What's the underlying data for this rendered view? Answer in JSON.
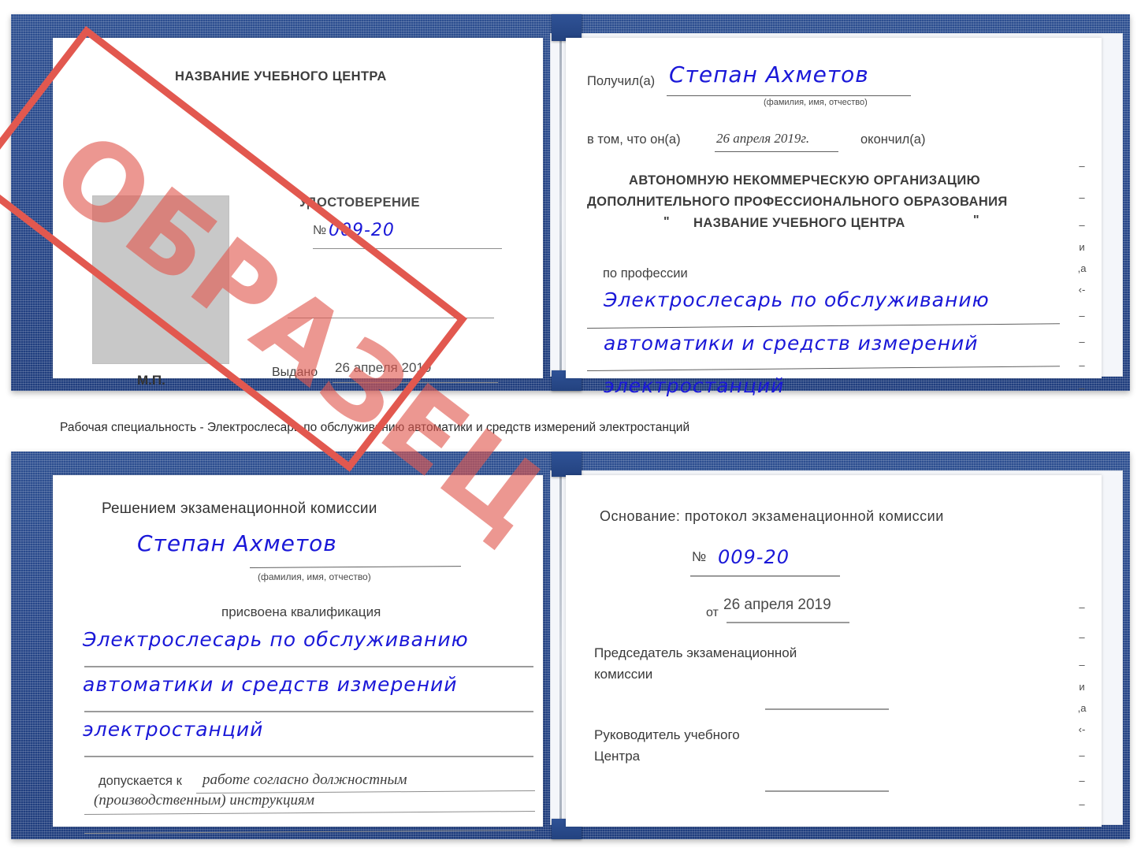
{
  "caption": "Рабочая специальность - Электрослесарь по обслуживанию автоматики и средств измерений электростанций",
  "stamp": {
    "label": "ОБРАЗЕЦ",
    "color": "#e2584f"
  },
  "colors": {
    "cover_blue": "#27478a",
    "handwriting_blue": "#1a18d8",
    "stamp_red": "#e2584f",
    "photo_placeholder_gray": "#c8c8c8"
  },
  "certificate_top": {
    "left_page": {
      "center_title": "НАЗВАНИЕ УЧЕБНОГО ЦЕНТРА",
      "doc_type": "УДОСТОВЕРЕНИЕ",
      "number_label": "№",
      "number_value": "009-20",
      "issued_label": "Выдано",
      "issued_value": "26 апреля 2019",
      "seal_label": "М.П."
    },
    "right_page": {
      "received_label": "Получил(а)",
      "received_value": "Степан Ахметов",
      "fio_hint": "(фамилия, имя, отчество)",
      "in_that_label": "в том, что он(а)",
      "in_that_value": "26 апреля 2019г.",
      "finished_label": "окончил(а)",
      "org_line1": "АВТОНОМНУЮ НЕКОММЕРЧЕСКУЮ ОРГАНИЗАЦИЮ",
      "org_line2": "ДОПОЛНИТЕЛЬНОГО ПРОФЕССИОНАЛЬНОГО ОБРАЗОВАНИЯ",
      "org_quote_open": "\"",
      "org_line3": "НАЗВАНИЕ УЧЕБНОГО ЦЕНТРА",
      "org_quote_close": "\"",
      "profession_label": "по профессии",
      "profession_line1": "Электрослесарь по обслуживанию",
      "profession_line2": "автоматики и средств измерений",
      "profession_line3": "электростанций",
      "edge_fragments": [
        "–",
        "–",
        "–",
        "и",
        ",а",
        "‹-",
        "–",
        "–",
        "–",
        "–"
      ]
    }
  },
  "certificate_bottom": {
    "left_page": {
      "heading": "Решением экзаменационной комиссии",
      "name_value": "Степан Ахметов",
      "fio_hint": "(фамилия, имя, отчество)",
      "qualification_label": "присвоена квалификация",
      "qualification_line1": "Электрослесарь по обслуживанию",
      "qualification_line2": "автоматики и средств измерений",
      "qualification_line3": "электростанций",
      "admitted_label": "допускается к",
      "admitted_value_line1": "работе согласно должностным",
      "admitted_value_line2": "(производственным) инструкциям"
    },
    "right_page": {
      "basis_label": "Основание: протокол экзаменационной комиссии",
      "number_label": "№",
      "number_value": "009-20",
      "date_label": "от",
      "date_value": "26 апреля 2019",
      "chairman_line1": "Председатель экзаменационной",
      "chairman_line2": "комиссии",
      "head_line1": "Руководитель учебного",
      "head_line2": "Центра",
      "edge_fragments": [
        "–",
        "–",
        "–",
        "и",
        ",а",
        "‹-",
        "–",
        "–",
        "–",
        "–"
      ]
    }
  }
}
